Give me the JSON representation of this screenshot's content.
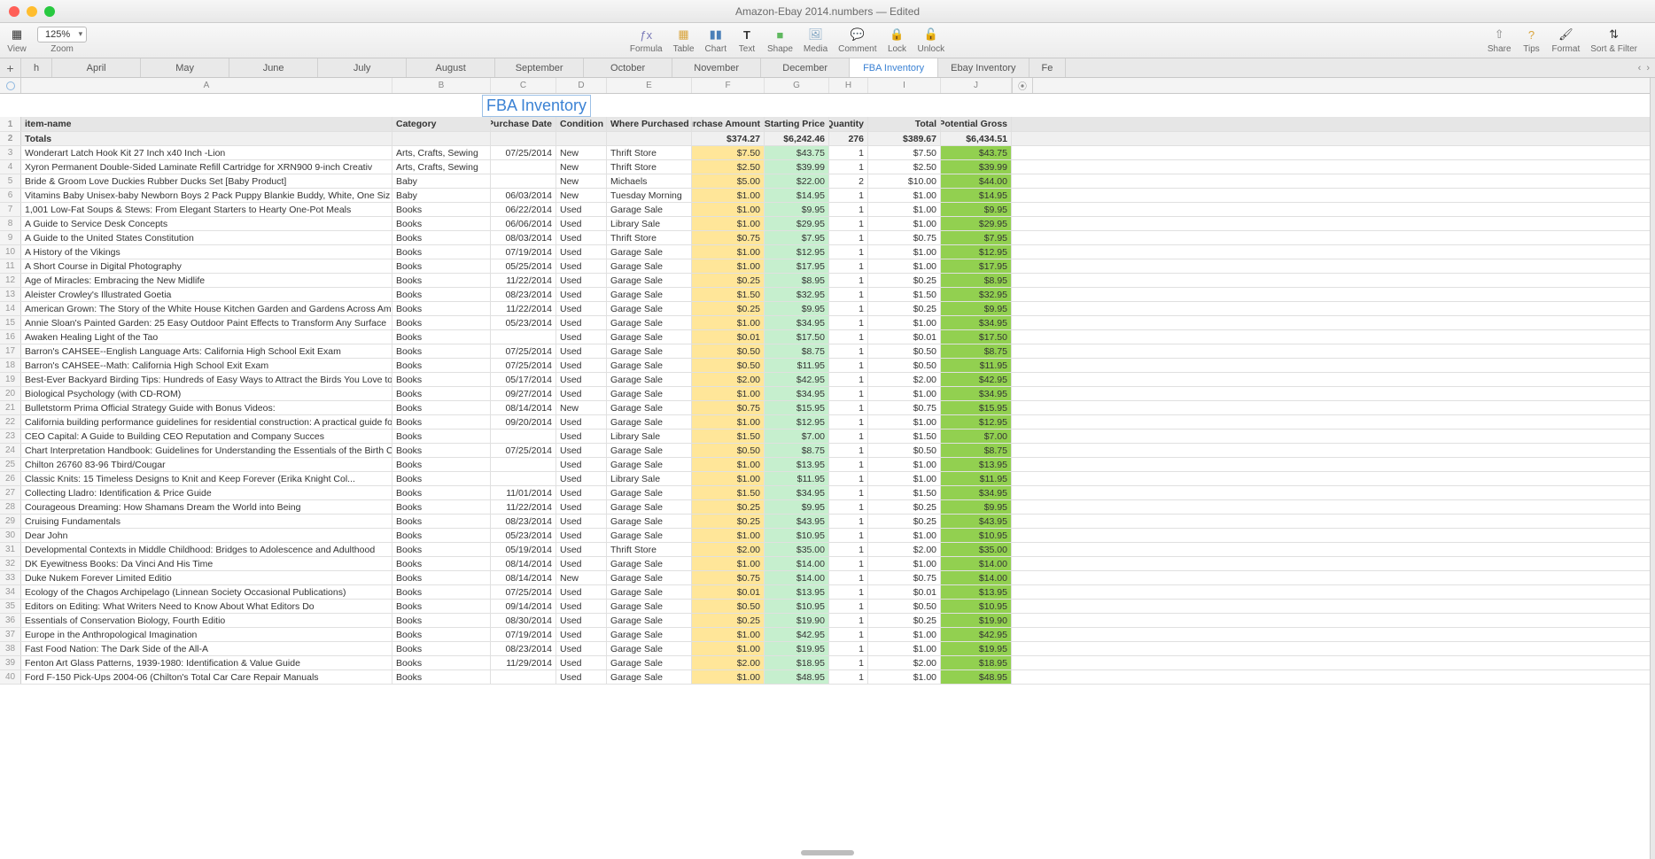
{
  "window_title": "Amazon-Ebay 2014.numbers — Edited",
  "zoom_value": "125%",
  "toolbar": {
    "view": "View",
    "zoom": "Zoom",
    "formula": "Formula",
    "table": "Table",
    "chart": "Chart",
    "text": "Text",
    "shape": "Shape",
    "media": "Media",
    "comment": "Comment",
    "lock": "Lock",
    "unlock": "Unlock",
    "share": "Share",
    "tips": "Tips",
    "format": "Format",
    "sort": "Sort & Filter"
  },
  "sheet_tabs": [
    "h",
    "April",
    "May",
    "June",
    "July",
    "August",
    "September",
    "October",
    "November",
    "December",
    "FBA Inventory",
    "Ebay Inventory",
    "Fe"
  ],
  "active_tab": "FBA Inventory",
  "col_letters": [
    "A",
    "B",
    "C",
    "D",
    "E",
    "F",
    "G",
    "H",
    "I",
    "J"
  ],
  "sheet_title": "FBA Inventory",
  "headers": {
    "item": "item-name",
    "cat": "Category",
    "date": "Purchase Date",
    "cond": "Condition",
    "where": "Where Purchased",
    "amt": "Purchase Amount",
    "sprice": "Starting Price",
    "qty": "Quantity",
    "total": "Total",
    "gross": "Potential Gross"
  },
  "totals": {
    "label": "Totals",
    "amt": "$374.27",
    "sprice": "$6,242.46",
    "qty": "276",
    "total": "$389.67",
    "gross": "$6,434.51"
  },
  "rows": [
    {
      "n": 3,
      "item": "Wonderart Latch Hook Kit 27 Inch x40 Inch -Lion",
      "cat": "Arts, Crafts, Sewing",
      "date": "07/25/2014",
      "cond": "New",
      "where": "Thrift Store",
      "amt": "$7.50",
      "sprice": "$43.75",
      "qty": "1",
      "total": "$7.50",
      "gross": "$43.75"
    },
    {
      "n": 4,
      "item": "Xyron Permanent Double-Sided Laminate Refill Cartridge for XRN900 9-inch Creativ",
      "cat": "Arts, Crafts, Sewing",
      "date": "",
      "cond": "New",
      "where": "Thrift Store",
      "amt": "$2.50",
      "sprice": "$39.99",
      "qty": "1",
      "total": "$2.50",
      "gross": "$39.99"
    },
    {
      "n": 5,
      "item": "Bride & Groom Love Duckies Rubber Ducks Set [Baby Product]",
      "cat": "Baby",
      "date": "",
      "cond": "New",
      "where": "Michaels",
      "amt": "$5.00",
      "sprice": "$22.00",
      "qty": "2",
      "total": "$10.00",
      "gross": "$44.00"
    },
    {
      "n": 6,
      "item": "Vitamins Baby Unisex-baby Newborn Boys 2 Pack Puppy Blankie Buddy, White, One Siz",
      "cat": "Baby",
      "date": "06/03/2014",
      "cond": "New",
      "where": "Tuesday Morning",
      "amt": "$1.00",
      "sprice": "$14.95",
      "qty": "1",
      "total": "$1.00",
      "gross": "$14.95"
    },
    {
      "n": 7,
      "item": "1,001 Low-Fat Soups & Stews: From Elegant Starters to Hearty One-Pot Meals",
      "cat": "Books",
      "date": "06/22/2014",
      "cond": "Used",
      "where": "Garage Sale",
      "amt": "$1.00",
      "sprice": "$9.95",
      "qty": "1",
      "total": "$1.00",
      "gross": "$9.95"
    },
    {
      "n": 8,
      "item": "A Guide to Service Desk Concepts",
      "cat": "Books",
      "date": "06/06/2014",
      "cond": "Used",
      "where": "Library Sale",
      "amt": "$1.00",
      "sprice": "$29.95",
      "qty": "1",
      "total": "$1.00",
      "gross": "$29.95"
    },
    {
      "n": 9,
      "item": "A Guide to the United States Constitution",
      "cat": "Books",
      "date": "08/03/2014",
      "cond": "Used",
      "where": "Thrift Store",
      "amt": "$0.75",
      "sprice": "$7.95",
      "qty": "1",
      "total": "$0.75",
      "gross": "$7.95"
    },
    {
      "n": 10,
      "item": "A History of the Vikings",
      "cat": "Books",
      "date": "07/19/2014",
      "cond": "Used",
      "where": "Garage Sale",
      "amt": "$1.00",
      "sprice": "$12.95",
      "qty": "1",
      "total": "$1.00",
      "gross": "$12.95"
    },
    {
      "n": 11,
      "item": "A Short Course in Digital Photography",
      "cat": "Books",
      "date": "05/25/2014",
      "cond": "Used",
      "where": "Garage Sale",
      "amt": "$1.00",
      "sprice": "$17.95",
      "qty": "1",
      "total": "$1.00",
      "gross": "$17.95"
    },
    {
      "n": 12,
      "item": "Age of Miracles: Embracing the New Midlife",
      "cat": "Books",
      "date": "11/22/2014",
      "cond": "Used",
      "where": "Garage Sale",
      "amt": "$0.25",
      "sprice": "$8.95",
      "qty": "1",
      "total": "$0.25",
      "gross": "$8.95"
    },
    {
      "n": 13,
      "item": "Aleister Crowley's Illustrated Goetia",
      "cat": "Books",
      "date": "08/23/2014",
      "cond": "Used",
      "where": "Garage Sale",
      "amt": "$1.50",
      "sprice": "$32.95",
      "qty": "1",
      "total": "$1.50",
      "gross": "$32.95"
    },
    {
      "n": 14,
      "item": "American Grown: The Story of the White House Kitchen Garden and Gardens Across America",
      "cat": "Books",
      "date": "11/22/2014",
      "cond": "Used",
      "where": "Garage Sale",
      "amt": "$0.25",
      "sprice": "$9.95",
      "qty": "1",
      "total": "$0.25",
      "gross": "$9.95"
    },
    {
      "n": 15,
      "item": "Annie Sloan's Painted Garden: 25 Easy Outdoor Paint Effects to Transform Any Surface",
      "cat": "Books",
      "date": "05/23/2014",
      "cond": "Used",
      "where": "Garage Sale",
      "amt": "$1.00",
      "sprice": "$34.95",
      "qty": "1",
      "total": "$1.00",
      "gross": "$34.95"
    },
    {
      "n": 16,
      "item": "Awaken Healing Light of the Tao",
      "cat": "Books",
      "date": "",
      "cond": "Used",
      "where": "Garage Sale",
      "amt": "$0.01",
      "sprice": "$17.50",
      "qty": "1",
      "total": "$0.01",
      "gross": "$17.50"
    },
    {
      "n": 17,
      "item": "Barron's CAHSEE--English Language Arts: California High School Exit Exam",
      "cat": "Books",
      "date": "07/25/2014",
      "cond": "Used",
      "where": "Garage Sale",
      "amt": "$0.50",
      "sprice": "$8.75",
      "qty": "1",
      "total": "$0.50",
      "gross": "$8.75"
    },
    {
      "n": 18,
      "item": "Barron's CAHSEE--Math: California High School Exit Exam",
      "cat": "Books",
      "date": "07/25/2014",
      "cond": "Used",
      "where": "Garage Sale",
      "amt": "$0.50",
      "sprice": "$11.95",
      "qty": "1",
      "total": "$0.50",
      "gross": "$11.95"
    },
    {
      "n": 19,
      "item": "Best-Ever Backyard Birding Tips: Hundreds of Easy Ways to Attract the Birds You Love to Watch",
      "cat": "Books",
      "date": "05/17/2014",
      "cond": "Used",
      "where": "Garage Sale",
      "amt": "$2.00",
      "sprice": "$42.95",
      "qty": "1",
      "total": "$2.00",
      "gross": "$42.95"
    },
    {
      "n": 20,
      "item": "Biological Psychology (with CD-ROM)",
      "cat": "Books",
      "date": "09/27/2014",
      "cond": "Used",
      "where": "Garage Sale",
      "amt": "$1.00",
      "sprice": "$34.95",
      "qty": "1",
      "total": "$1.00",
      "gross": "$34.95"
    },
    {
      "n": 21,
      "item": "Bulletstorm Prima Official Strategy Guide with Bonus Videos:",
      "cat": "Books",
      "date": "08/14/2014",
      "cond": "New",
      "where": "Garage Sale",
      "amt": "$0.75",
      "sprice": "$15.95",
      "qty": "1",
      "total": "$0.75",
      "gross": "$15.95"
    },
    {
      "n": 22,
      "item": "California building performance guidelines for residential construction: A practical guide for owners of new homes : constr",
      "cat": "Books",
      "date": "09/20/2014",
      "cond": "Used",
      "where": "Garage Sale",
      "amt": "$1.00",
      "sprice": "$12.95",
      "qty": "1",
      "total": "$1.00",
      "gross": "$12.95"
    },
    {
      "n": 23,
      "item": "CEO Capital: A Guide to Building CEO Reputation and Company Succes",
      "cat": "Books",
      "date": "",
      "cond": "Used",
      "where": "Library Sale",
      "amt": "$1.50",
      "sprice": "$7.00",
      "qty": "1",
      "total": "$1.50",
      "gross": "$7.00"
    },
    {
      "n": 24,
      "item": "Chart Interpretation Handbook: Guidelines for Understanding the Essentials of the Birth Chart",
      "cat": "Books",
      "date": "07/25/2014",
      "cond": "Used",
      "where": "Garage Sale",
      "amt": "$0.50",
      "sprice": "$8.75",
      "qty": "1",
      "total": "$0.50",
      "gross": "$8.75"
    },
    {
      "n": 25,
      "item": "Chilton 26760 83-96 Tbird/Cougar",
      "cat": "Books",
      "date": "",
      "cond": "Used",
      "where": "Garage Sale",
      "amt": "$1.00",
      "sprice": "$13.95",
      "qty": "1",
      "total": "$1.00",
      "gross": "$13.95"
    },
    {
      "n": 26,
      "item": "Classic Knits: 15 Timeless Designs to Knit and Keep Forever (Erika Knight Col...",
      "cat": "Books",
      "date": "",
      "cond": "Used",
      "where": "Library Sale",
      "amt": "$1.00",
      "sprice": "$11.95",
      "qty": "1",
      "total": "$1.00",
      "gross": "$11.95"
    },
    {
      "n": 27,
      "item": "Collecting Lladro: Identification & Price Guide",
      "cat": "Books",
      "date": "11/01/2014",
      "cond": "Used",
      "where": "Garage Sale",
      "amt": "$1.50",
      "sprice": "$34.95",
      "qty": "1",
      "total": "$1.50",
      "gross": "$34.95"
    },
    {
      "n": 28,
      "item": "Courageous Dreaming: How Shamans Dream the World into Being",
      "cat": "Books",
      "date": "11/22/2014",
      "cond": "Used",
      "where": "Garage Sale",
      "amt": "$0.25",
      "sprice": "$9.95",
      "qty": "1",
      "total": "$0.25",
      "gross": "$9.95"
    },
    {
      "n": 29,
      "item": "Cruising Fundamentals",
      "cat": "Books",
      "date": "08/23/2014",
      "cond": "Used",
      "where": "Garage Sale",
      "amt": "$0.25",
      "sprice": "$43.95",
      "qty": "1",
      "total": "$0.25",
      "gross": "$43.95"
    },
    {
      "n": 30,
      "item": "Dear John",
      "cat": "Books",
      "date": "05/23/2014",
      "cond": "Used",
      "where": "Garage Sale",
      "amt": "$1.00",
      "sprice": "$10.95",
      "qty": "1",
      "total": "$1.00",
      "gross": "$10.95"
    },
    {
      "n": 31,
      "item": "Developmental Contexts in Middle Childhood: Bridges to Adolescence and Adulthood",
      "cat": "Books",
      "date": "05/19/2014",
      "cond": "Used",
      "where": "Thrift Store",
      "amt": "$2.00",
      "sprice": "$35.00",
      "qty": "1",
      "total": "$2.00",
      "gross": "$35.00"
    },
    {
      "n": 32,
      "item": "DK Eyewitness Books: Da Vinci And His Time",
      "cat": "Books",
      "date": "08/14/2014",
      "cond": "Used",
      "where": "Garage Sale",
      "amt": "$1.00",
      "sprice": "$14.00",
      "qty": "1",
      "total": "$1.00",
      "gross": "$14.00"
    },
    {
      "n": 33,
      "item": "Duke Nukem Forever Limited Editio",
      "cat": "Books",
      "date": "08/14/2014",
      "cond": "New",
      "where": "Garage Sale",
      "amt": "$0.75",
      "sprice": "$14.00",
      "qty": "1",
      "total": "$0.75",
      "gross": "$14.00"
    },
    {
      "n": 34,
      "item": "Ecology of the Chagos Archipelago (Linnean Society Occasional Publications)",
      "cat": "Books",
      "date": "07/25/2014",
      "cond": "Used",
      "where": "Garage Sale",
      "amt": "$0.01",
      "sprice": "$13.95",
      "qty": "1",
      "total": "$0.01",
      "gross": "$13.95"
    },
    {
      "n": 35,
      "item": "Editors on Editing: What Writers Need to Know About What Editors Do",
      "cat": "Books",
      "date": "09/14/2014",
      "cond": "Used",
      "where": "Garage Sale",
      "amt": "$0.50",
      "sprice": "$10.95",
      "qty": "1",
      "total": "$0.50",
      "gross": "$10.95"
    },
    {
      "n": 36,
      "item": "Essentials of Conservation Biology, Fourth Editio",
      "cat": "Books",
      "date": "08/30/2014",
      "cond": "Used",
      "where": "Garage Sale",
      "amt": "$0.25",
      "sprice": "$19.90",
      "qty": "1",
      "total": "$0.25",
      "gross": "$19.90"
    },
    {
      "n": 37,
      "item": "Europe in the Anthropological Imagination",
      "cat": "Books",
      "date": "07/19/2014",
      "cond": "Used",
      "where": "Garage Sale",
      "amt": "$1.00",
      "sprice": "$42.95",
      "qty": "1",
      "total": "$1.00",
      "gross": "$42.95"
    },
    {
      "n": 38,
      "item": "Fast Food Nation: The Dark Side of the All-A",
      "cat": "Books",
      "date": "08/23/2014",
      "cond": "Used",
      "where": "Garage Sale",
      "amt": "$1.00",
      "sprice": "$19.95",
      "qty": "1",
      "total": "$1.00",
      "gross": "$19.95"
    },
    {
      "n": 39,
      "item": "Fenton Art Glass Patterns, 1939-1980: Identification & Value Guide",
      "cat": "Books",
      "date": "11/29/2014",
      "cond": "Used",
      "where": "Garage Sale",
      "amt": "$2.00",
      "sprice": "$18.95",
      "qty": "1",
      "total": "$2.00",
      "gross": "$18.95"
    },
    {
      "n": 40,
      "item": "Ford F-150 Pick-Ups 2004-06 (Chilton's Total Car Care Repair Manuals",
      "cat": "Books",
      "date": "",
      "cond": "Used",
      "where": "Garage Sale",
      "amt": "$1.00",
      "sprice": "$48.95",
      "qty": "1",
      "total": "$1.00",
      "gross": "$48.95"
    }
  ]
}
